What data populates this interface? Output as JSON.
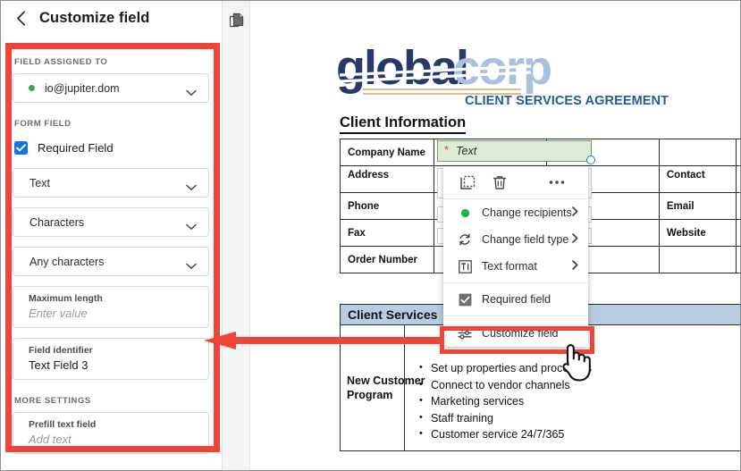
{
  "sidebar": {
    "back_icon": "chevron-left-icon",
    "title": "Customize field",
    "section_assigned_label": "FIELD ASSIGNED TO",
    "recipient": {
      "value": "io@jupiter.dom",
      "dot_color": "#36a84f",
      "chevron": "chevron-down-icon"
    },
    "section_formfield_label": "FORM FIELD",
    "required_field": {
      "label": "Required Field",
      "checked": true,
      "accent": "#1473e6"
    },
    "field_type_select": "Text",
    "length_unit_select": "Characters",
    "charset_select": "Any characters",
    "max_length": {
      "label": "Maximum length",
      "placeholder": "Enter value"
    },
    "field_identifier": {
      "label": "Field identifier",
      "value": "Text Field 3"
    },
    "section_more_label": "MORE SETTINGS",
    "prefill": {
      "label": "Prefill text field",
      "placeholder": "Add text"
    }
  },
  "doc_toolbar": {
    "pages_icon": "pages-icon"
  },
  "document": {
    "logo": {
      "word1": "global",
      "word2": "corp",
      "color1": "#27386b",
      "color2": "#a9c0de"
    },
    "agreement_title": "CLIENT SERVICES AGREEMENT",
    "section_heading": "Client Information",
    "table_rows": [
      {
        "label": "Company Name",
        "value": "",
        "label2": "",
        "value2": ""
      },
      {
        "label": "Address",
        "value": "",
        "label2": "Contact",
        "value2": ""
      },
      {
        "label": "Phone",
        "value": "",
        "label2": "Email",
        "value2": ""
      },
      {
        "label": "Fax",
        "value": "",
        "label2": "Website",
        "value2": ""
      },
      {
        "label": "Order Number",
        "value": "",
        "label2": "",
        "value2": ""
      }
    ],
    "active_field": {
      "required_marker": "*",
      "label": "Text",
      "fill_color": "#dcead6",
      "border_color": "#6d9c5e",
      "handle_color": "#2a7ad4"
    },
    "services": {
      "heading": "Client Services",
      "header_bg": "#b8cce4",
      "row_label": "New Customer Program",
      "bullets": [
        "Set up properties and processes",
        "Connect to vendor channels",
        "Marketing services",
        "Staff training",
        "Customer service 24/7/365"
      ]
    }
  },
  "context_menu": {
    "top_icons": [
      {
        "name": "duplicate-icon"
      },
      {
        "name": "delete-icon"
      },
      {
        "name": "more-options-icon"
      }
    ],
    "items": [
      {
        "icon": "recipient-dot-icon",
        "label": "Change recipients",
        "has_submenu": true
      },
      {
        "icon": "refresh-icon",
        "label": "Change field type",
        "has_submenu": true
      },
      {
        "icon": "text-format-icon",
        "label": "Text format",
        "has_submenu": true
      },
      {
        "icon": "checkbox-checked-icon",
        "label": "Required field",
        "has_submenu": false
      },
      {
        "icon": "sliders-icon",
        "label": "Customize field",
        "has_submenu": false
      }
    ]
  },
  "annotations": {
    "highlight_color": "#f04438",
    "arrow_direction": "left",
    "cursor": "pointing-hand-cursor"
  }
}
